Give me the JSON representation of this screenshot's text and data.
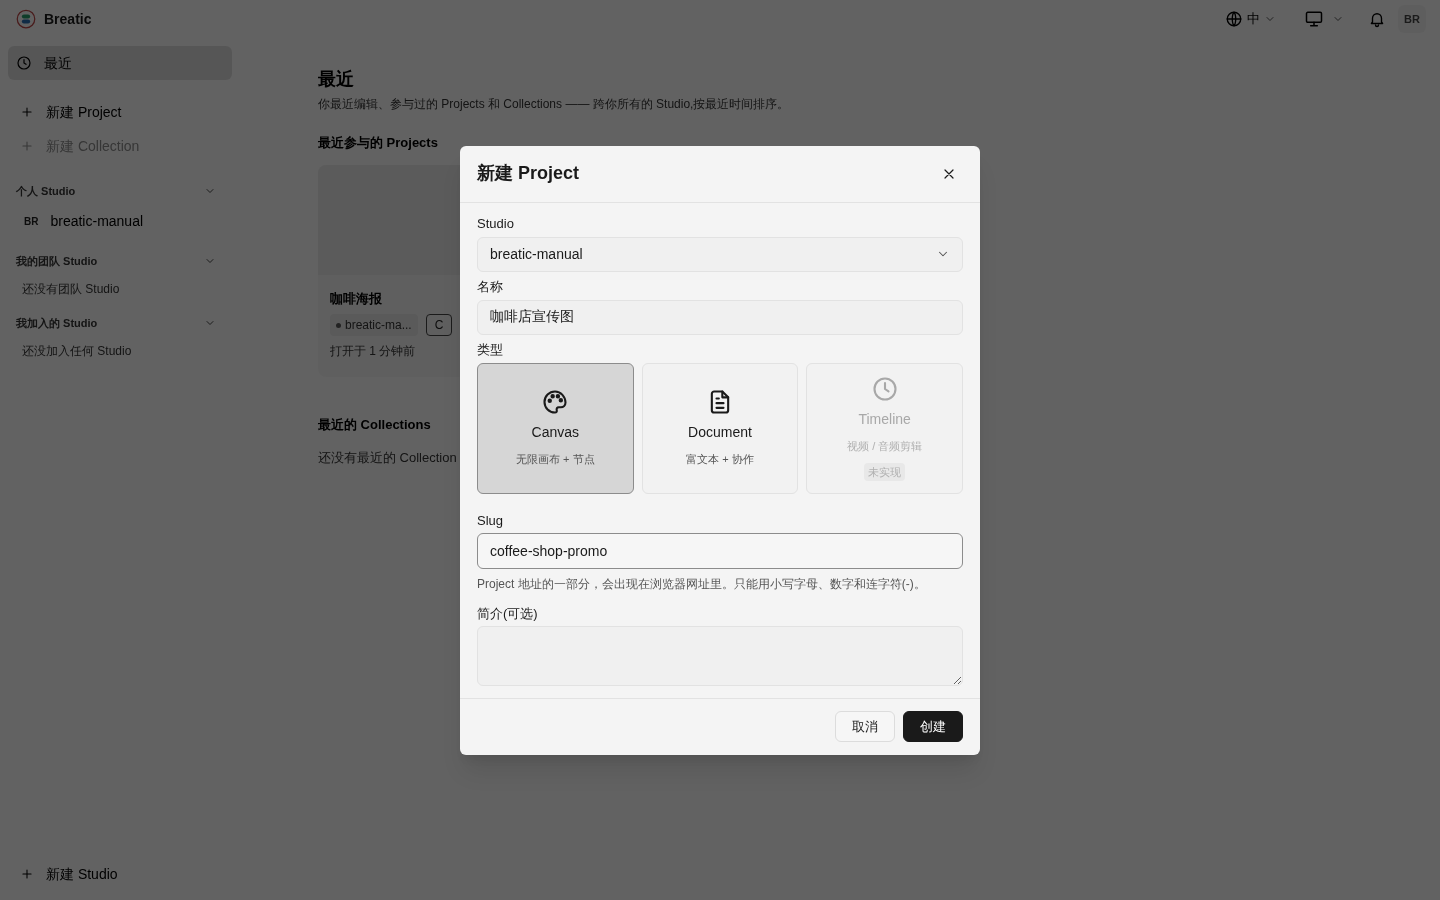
{
  "app": {
    "name": "Breatic"
  },
  "header": {
    "language": "中",
    "avatar": "BR"
  },
  "sidebar": {
    "nav": [
      {
        "label": "最近",
        "selected": true
      }
    ],
    "actions": [
      {
        "label": "新建 Project",
        "disabled": false
      },
      {
        "label": "新建 Collection",
        "disabled": true
      }
    ],
    "sections": [
      {
        "title": "个人 Studio",
        "expanded": true,
        "items": [
          {
            "badge": "BR",
            "label": "breatic-manual"
          }
        ]
      },
      {
        "title": "我的团队 Studio",
        "expanded": true,
        "empty": "还没有团队 Studio"
      },
      {
        "title": "我加入的 Studio",
        "expanded": true,
        "empty": "还没加入任何 Studio"
      }
    ],
    "footer_action": "新建 Studio"
  },
  "main": {
    "title": "最近",
    "subtitle": "你最近编辑、参与过的 Projects 和 Collections —— 跨你所有的 Studio,按最近时间排序。",
    "projects_heading": "最近参与的 Projects",
    "projects": [
      {
        "title": "咖啡海报",
        "studio": "breatic-ma...",
        "tag": "C",
        "opened": "打开于 1 分钟前"
      }
    ],
    "collections_heading": "最近的 Collections",
    "collections_empty": "还没有最近的 Collection"
  },
  "dialog": {
    "title": "新建 Project",
    "studio": {
      "label": "Studio",
      "value": "breatic-manual"
    },
    "name": {
      "label": "名称",
      "value": "咖啡店宣传图"
    },
    "type": {
      "label": "类型",
      "options": [
        {
          "kind": "palette",
          "title": "Canvas",
          "subtitle": "无限画布 + 节点",
          "selected": true,
          "disabled": false
        },
        {
          "kind": "document",
          "title": "Document",
          "subtitle": "富文本 + 协作",
          "selected": false,
          "disabled": false
        },
        {
          "kind": "clock",
          "title": "Timeline",
          "subtitle": "视频 / 音频剪辑",
          "badge": "未实现",
          "selected": false,
          "disabled": true
        }
      ]
    },
    "slug": {
      "label": "Slug",
      "value": "coffee-shop-promo",
      "help": "Project 地址的一部分，会出现在浏览器网址里。只能用小写字母、数字和连字符(-)。"
    },
    "description": {
      "label": "简介(可选)"
    },
    "buttons": [
      {
        "kind": "secondary",
        "label": "取消"
      },
      {
        "kind": "primary",
        "label": "创建"
      }
    ]
  }
}
